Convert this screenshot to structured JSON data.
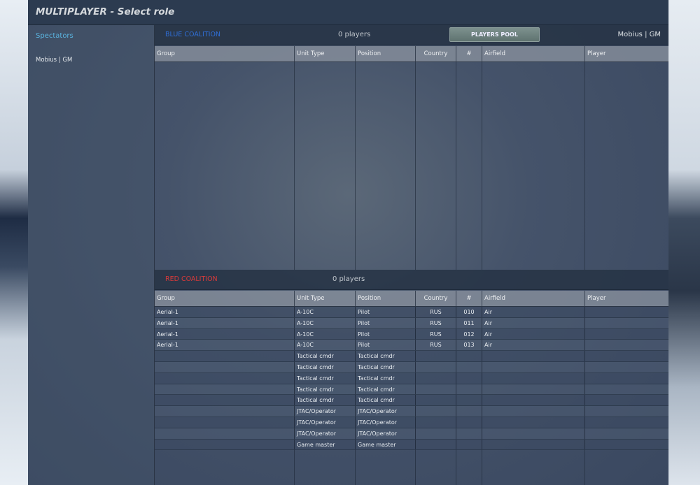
{
  "title": "MULTIPLAYER - Select role",
  "sidebar": {
    "spectators_label": "Spectators",
    "members": [
      "Mobius | GM"
    ]
  },
  "blue": {
    "name": "BLUE COALITION",
    "players": "0 players",
    "pool_button": "PLAYERS POOL",
    "current_user": "Mobius | GM",
    "color": "#2f6fd8"
  },
  "red": {
    "name": "RED COALITION",
    "players": "0 players",
    "color": "#d83a3a"
  },
  "columns": [
    "Group",
    "Unit Type",
    "Position",
    "Country",
    "#",
    "Airfield",
    "Player"
  ],
  "red_rows": [
    [
      "Aerial-1",
      "A-10C",
      "Pilot",
      "RUS",
      "010",
      "Air",
      ""
    ],
    [
      "Aerial-1",
      "A-10C",
      "Pilot",
      "RUS",
      "011",
      "Air",
      ""
    ],
    [
      "Aerial-1",
      "A-10C",
      "Pilot",
      "RUS",
      "012",
      "Air",
      ""
    ],
    [
      "Aerial-1",
      "A-10C",
      "Pilot",
      "RUS",
      "013",
      "Air",
      ""
    ],
    [
      "",
      "Tactical cmdr",
      "Tactical cmdr",
      "",
      "",
      "",
      ""
    ],
    [
      "",
      "Tactical cmdr",
      "Tactical cmdr",
      "",
      "",
      "",
      ""
    ],
    [
      "",
      "Tactical cmdr",
      "Tactical cmdr",
      "",
      "",
      "",
      ""
    ],
    [
      "",
      "Tactical cmdr",
      "Tactical cmdr",
      "",
      "",
      "",
      ""
    ],
    [
      "",
      "Tactical cmdr",
      "Tactical cmdr",
      "",
      "",
      "",
      ""
    ],
    [
      "",
      "JTAC/Operator",
      "JTAC/Operator",
      "",
      "",
      "",
      ""
    ],
    [
      "",
      "JTAC/Operator",
      "JTAC/Operator",
      "",
      "",
      "",
      ""
    ],
    [
      "",
      "JTAC/Operator",
      "JTAC/Operator",
      "",
      "",
      "",
      ""
    ],
    [
      "",
      "Game master",
      "Game master",
      "",
      "",
      "",
      ""
    ]
  ]
}
